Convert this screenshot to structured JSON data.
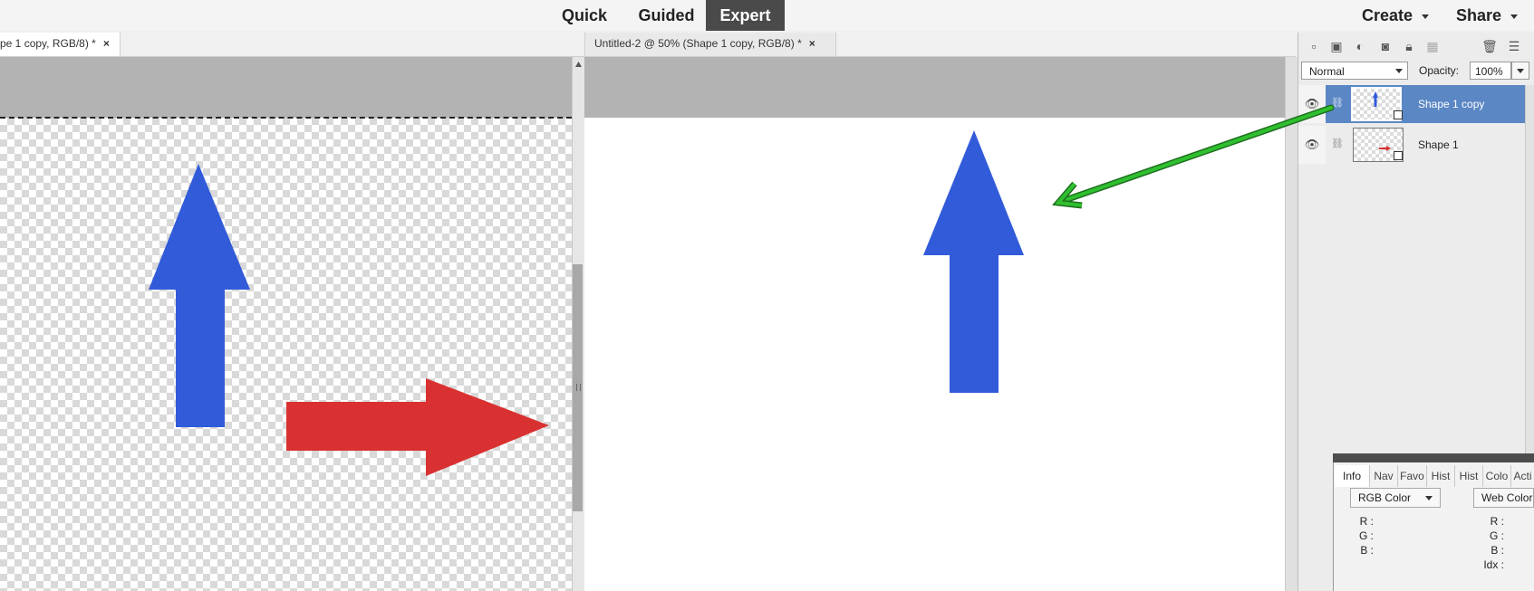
{
  "modes": {
    "quick": "Quick",
    "guided": "Guided",
    "expert": "Expert"
  },
  "topright": {
    "create": "Create",
    "share": "Share"
  },
  "tabs": [
    {
      "title": "pe 1 copy, RGB/8) *",
      "close": "×"
    },
    {
      "title": "Untitled-2 @ 50% (Shape 1 copy, RGB/8) *",
      "close": "×"
    }
  ],
  "layers_panel": {
    "blend_mode": "Normal",
    "opacity_label": "Opacity:",
    "opacity_value": "100%",
    "toolbar_icons": [
      "new-layer-icon",
      "new-group-icon",
      "adjustment-layer-icon",
      "layer-mask-icon",
      "lock-all-icon",
      "lock-transparency-icon",
      "delete-layer-icon",
      "panel-menu-icon"
    ],
    "layers": [
      {
        "name": "Shape 1 copy",
        "selected": true,
        "thumbnail": "blue-up-arrow"
      },
      {
        "name": "Shape 1",
        "selected": false,
        "thumbnail": "red-right-arrow"
      }
    ]
  },
  "info_panel": {
    "tabs": [
      "Info",
      "Nav",
      "Favo",
      "Hist",
      "Hist",
      "Colo",
      "Acti"
    ],
    "left_mode": "RGB Color",
    "right_mode": "Web Color",
    "left_labels": [
      "R :",
      "G :",
      "B :"
    ],
    "right_labels": [
      "R :",
      "G :",
      "B :",
      "Idx :"
    ]
  },
  "colors": {
    "blue_arrow": "#315bd9",
    "red_arrow": "#d93131",
    "annotation_arrow": "#2fbf2f",
    "selected_layer": "#5b87c4",
    "expert_tab": "#4a4a4a"
  }
}
